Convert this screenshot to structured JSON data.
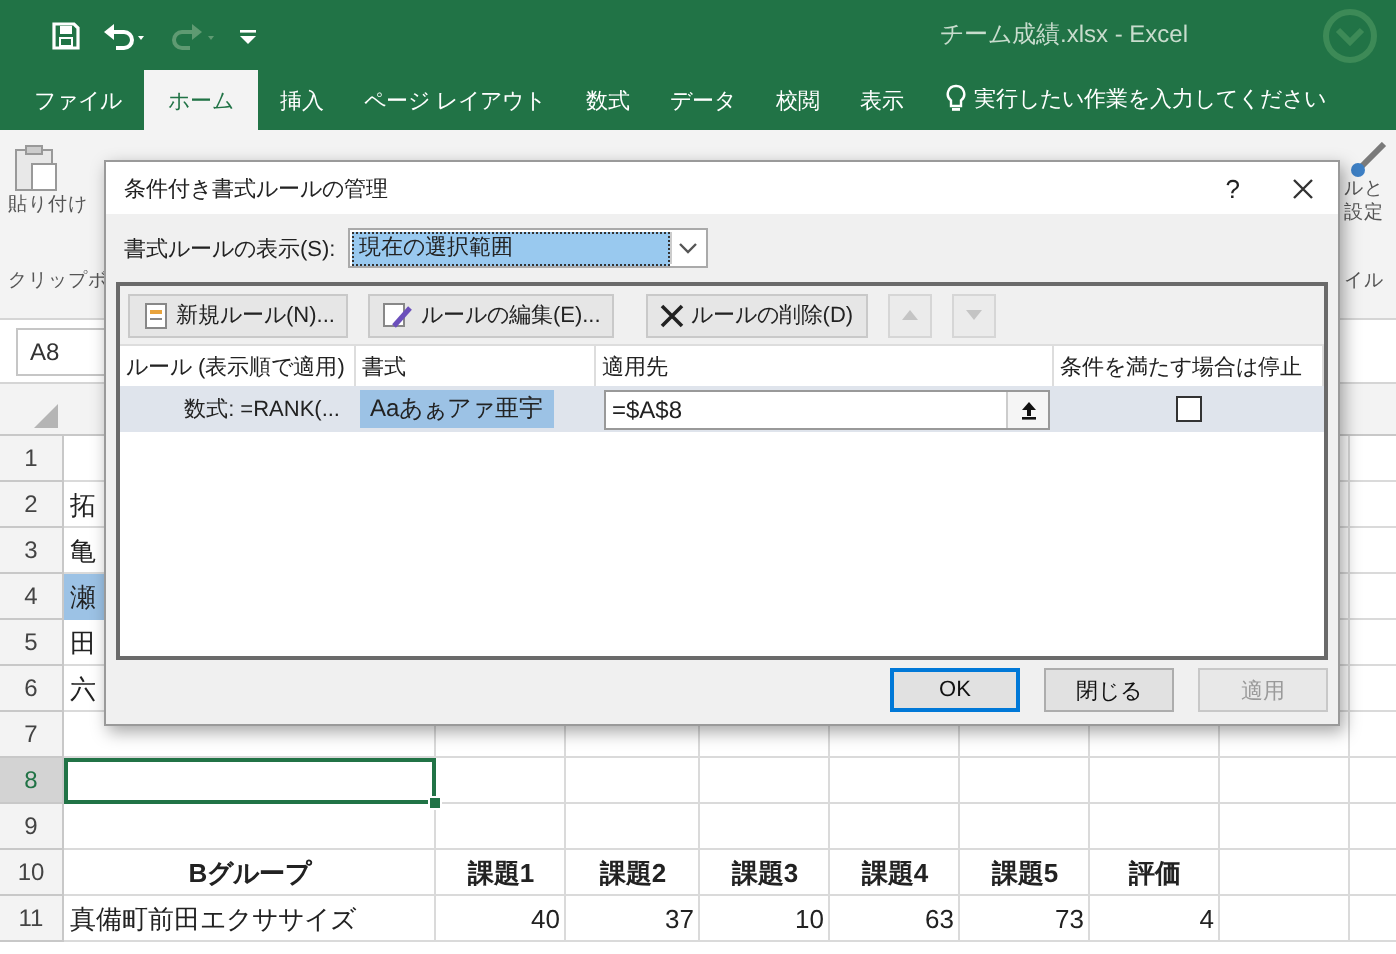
{
  "window": {
    "title": "チーム成績.xlsx - Excel"
  },
  "ribbon_tabs": [
    {
      "label": "ファイル",
      "selected": false
    },
    {
      "label": "ホーム",
      "selected": true
    },
    {
      "label": "挿入",
      "selected": false
    },
    {
      "label": "ページ レイアウト",
      "selected": false
    },
    {
      "label": "数式",
      "selected": false
    },
    {
      "label": "データ",
      "selected": false
    },
    {
      "label": "校閲",
      "selected": false
    },
    {
      "label": "表示",
      "selected": false
    }
  ],
  "tell_me": {
    "placeholder": "実行したい作業を入力してください"
  },
  "ribbon": {
    "paste_label": "貼り付け",
    "clipboard_group": "クリップボ",
    "right_label_line_1": "ルと",
    "right_label_line_2": "設定",
    "right_group": "イル"
  },
  "name_box": {
    "value": "A8"
  },
  "sheet": {
    "rows": [
      {
        "header": "1",
        "selected": false
      },
      {
        "header": "2",
        "selected": false,
        "kind": "clipped",
        "cells": [
          {
            "text": "拓",
            "highlighted": false
          }
        ]
      },
      {
        "header": "3",
        "selected": false,
        "kind": "clipped",
        "cells": [
          {
            "text": "亀",
            "highlighted": false
          }
        ]
      },
      {
        "header": "4",
        "selected": false,
        "kind": "clipped",
        "cells": [
          {
            "text": "瀬",
            "highlighted": true
          }
        ]
      },
      {
        "header": "5",
        "selected": false,
        "kind": "clipped",
        "cells": [
          {
            "text": "田",
            "highlighted": false
          }
        ]
      },
      {
        "header": "6",
        "selected": false,
        "kind": "clipped",
        "cells": [
          {
            "text": "六",
            "highlighted": false
          }
        ]
      },
      {
        "header": "7",
        "selected": false
      },
      {
        "header": "8",
        "selected": true
      },
      {
        "header": "9",
        "selected": false
      },
      {
        "header": "10",
        "selected": false,
        "kind": "heading",
        "cells": [
          {
            "text": "Bグループ"
          },
          {
            "text": "課題1"
          },
          {
            "text": "課題2"
          },
          {
            "text": "課題3"
          },
          {
            "text": "課題4"
          },
          {
            "text": "課題5"
          },
          {
            "text": "評価"
          }
        ]
      },
      {
        "header": "11",
        "selected": false,
        "kind": "data",
        "cells": [
          {
            "text": "真備町前田エクササイズ"
          },
          {
            "text": "40"
          },
          {
            "text": "37"
          },
          {
            "text": "10"
          },
          {
            "text": "63"
          },
          {
            "text": "73"
          },
          {
            "text": "4"
          }
        ]
      }
    ]
  },
  "dialog": {
    "title": "条件付き書式ルールの管理",
    "help": "?",
    "show_rules_for": {
      "label": "書式ルールの表示(S):",
      "value": "現在の選択範囲"
    },
    "toolbar": [
      {
        "label": "新規ルール(N)...",
        "kind": "new"
      },
      {
        "label": "ルールの編集(E)...",
        "kind": "edit"
      },
      {
        "label": "ルールの削除(D)",
        "kind": "delete"
      }
    ],
    "move_up": {
      "disabled": true
    },
    "move_down": {
      "disabled": true
    },
    "columns": [
      "ルール (表示順で適用)",
      "書式",
      "適用先",
      "条件を満たす場合は停止"
    ],
    "rules": [
      {
        "rule": "数式: =RANK(...",
        "preview": "Aaあぁアァ亜宇",
        "applies_to": "=$A$8",
        "stop_if_true": false,
        "selected": true
      }
    ],
    "buttons": [
      {
        "label": "OK",
        "default": true,
        "disabled": false
      },
      {
        "label": "閉じる",
        "default": false,
        "disabled": false
      },
      {
        "label": "適用",
        "default": false,
        "disabled": true
      }
    ]
  }
}
